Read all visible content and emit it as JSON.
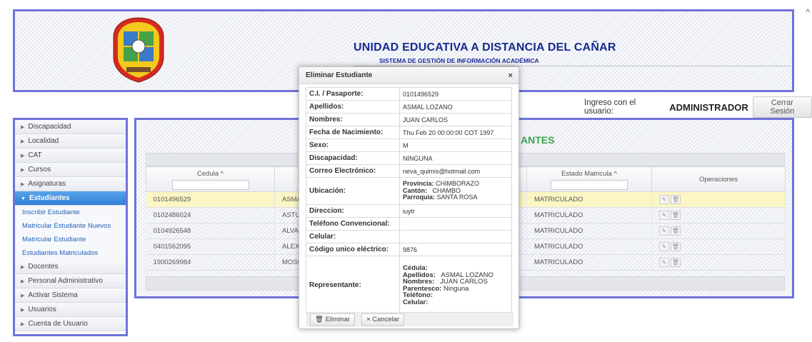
{
  "header": {
    "title": "UNIDAD EDUCATIVA A DISTANCIA DEL CAÑAR",
    "subtitle": "SISTEMA DE GESTIÓN DE INFORMACIÓN ACADÉMICA"
  },
  "userbar": {
    "label": "Ingreso con el usuario:",
    "username": "ADMINISTRADOR",
    "logout": "Cerrar Sesión"
  },
  "sidebar": {
    "items": [
      {
        "label": "Discapacidad"
      },
      {
        "label": "Localidad"
      },
      {
        "label": "CAT"
      },
      {
        "label": "Cursos"
      },
      {
        "label": "Asignaturas"
      },
      {
        "label": "Estudiantes",
        "active": true
      },
      {
        "label": "Docentes"
      },
      {
        "label": "Personal Administrativo"
      },
      {
        "label": "Activar Sistema"
      },
      {
        "label": "Usuarios"
      },
      {
        "label": "Cuenta de Usuario"
      }
    ],
    "subitems": [
      {
        "label": "Inscribir Estudiante"
      },
      {
        "label": "Matricular Estudiante Nuevos"
      },
      {
        "label": "Matricular Estudiante"
      },
      {
        "label": "Estudiantes Matriculados"
      }
    ]
  },
  "main": {
    "title_visible": "ANTES",
    "columns": {
      "cedula": "Cedula ^",
      "estado": "Estado Matricula ^",
      "operaciones": "Operaciones"
    },
    "rows": [
      {
        "cedula": "0101496529",
        "nombre": "ASMA",
        "estado": "MATRICULADO"
      },
      {
        "cedula": "0102486024",
        "nombre": "ASTU",
        "estado": "MATRICULADO"
      },
      {
        "cedula": "0104926548",
        "nombre": "ALVAR",
        "estado": "MATRICULADO"
      },
      {
        "cedula": "0401562095",
        "nombre": "ALEX",
        "estado": "MATRICULADO"
      },
      {
        "cedula": "1900269984",
        "nombre": "MOSO",
        "estado": "MATRICULADO"
      }
    ]
  },
  "dialog": {
    "title": "Eliminar Estudiante",
    "close": "×",
    "fields": {
      "ci_label": "C.I. / Pasaporte:",
      "ci": "0101496529",
      "apellidos_label": "Apellidos:",
      "apellidos": "ASMAL LOZANO",
      "nombres_label": "Nombres:",
      "nombres": "JUAN CARLOS",
      "fecha_label": "Fecha de Nacimiento:",
      "fecha": "Thu Feb 20 00:00:00 COT 1997",
      "sexo_label": "Sexo:",
      "sexo": "M",
      "discapacidad_label": "Discapacidad:",
      "discapacidad": "NINGUNA",
      "correo_label": "Correo Electrónico:",
      "correo": "neva_quimis@hotmail.com",
      "ubicacion_label": "Ubicación:",
      "provincia_label": "Provincia:",
      "provincia": "CHIMBORAZO",
      "canton_label": "Cantón:",
      "canton": "CHAMBO",
      "parroquia_label": "Parroquia:",
      "parroquia": "SANTA ROSA",
      "direccion_label": "Direccion:",
      "direccion": "iuytr",
      "telconv_label": "Teléfono Convencional:",
      "telconv": "",
      "celular_label": "Celular:",
      "celular": "",
      "codigo_label": "Código unico eléctrico:",
      "codigo": "9876",
      "representante_label": "Representante:",
      "rep_cedula_label": "Cédula:",
      "rep_cedula": "",
      "rep_apellidos_label": "Apellidos:",
      "rep_apellidos": "ASMAL LOZANO",
      "rep_nombres_label": "Nombres:",
      "rep_nombres": "JUAN CARLOS",
      "rep_parentesco_label": "Parentesco:",
      "rep_parentesco": "Ninguna",
      "rep_telefono_label": "Teléfono:",
      "rep_telefono": "",
      "rep_celular_label": "Celular:",
      "rep_celular": ""
    },
    "buttons": {
      "delete": "Eliminar",
      "cancel": "Cancelar"
    }
  },
  "icons": {
    "caret": "caret-right-icon",
    "edit": "pencil-icon",
    "delete": "trash-icon"
  },
  "colors": {
    "frame": "#6f73d9",
    "title": "#162b8f",
    "active_menu": "#2e7fd4",
    "green_title": "#38a34a",
    "selected_row": "#fbf6c4"
  }
}
